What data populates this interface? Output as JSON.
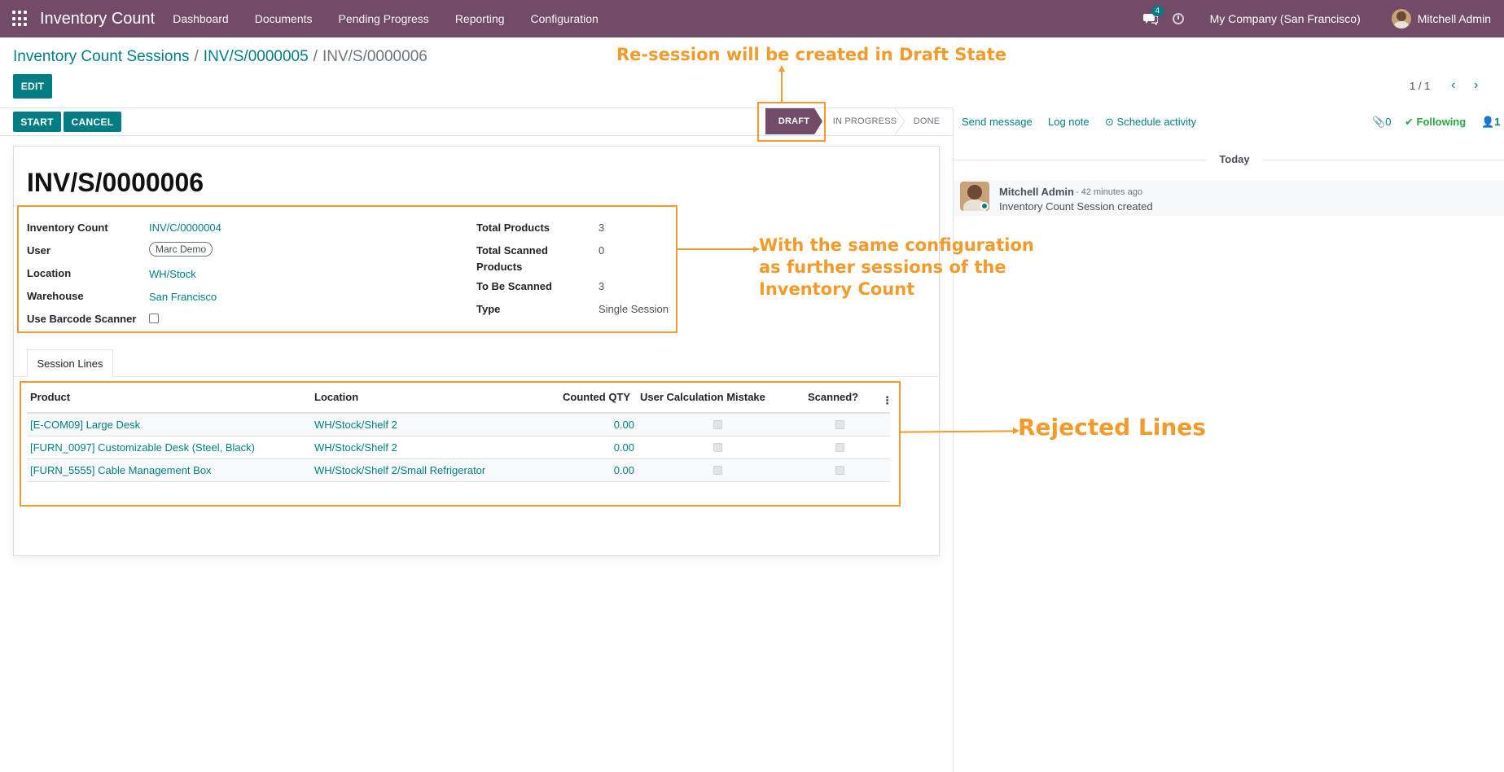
{
  "navbar": {
    "app_name": "Inventory Count",
    "menu": [
      "Dashboard",
      "Documents",
      "Pending Progress",
      "Reporting",
      "Configuration"
    ],
    "chat_count": "4",
    "company": "My Company (San Francisco)",
    "user": "Mitchell Admin",
    "color": "#714B67"
  },
  "breadcrumb": {
    "root": "Inventory Count Sessions",
    "parent": "INV/S/0000005",
    "current": "INV/S/0000006",
    "sep": "/"
  },
  "control": {
    "edit_label": "EDIT",
    "pager": "1 / 1"
  },
  "statusbar": {
    "start_label": "START",
    "cancel_label": "CANCEL",
    "stages": [
      "DRAFT",
      "IN PROGRESS",
      "DONE"
    ],
    "active_stage": "DRAFT"
  },
  "form": {
    "title": "INV/S/0000006",
    "left_fields": [
      {
        "label": "Inventory Count",
        "value": "INV/C/0000004"
      },
      {
        "label": "User",
        "value": "Marc Demo"
      },
      {
        "label": "Location",
        "value": "WH/Stock"
      },
      {
        "label": "Warehouse",
        "value": "San Francisco"
      },
      {
        "label": "Use Barcode Scanner",
        "value": ""
      }
    ],
    "right_fields": [
      {
        "label": "Total Products",
        "value": "3"
      },
      {
        "label_line1": "Total Scanned",
        "label_line2": "Products",
        "value": "0"
      },
      {
        "label": "To Be Scanned",
        "value": "3"
      },
      {
        "label": "Type",
        "value": "Single Session"
      }
    ]
  },
  "tabs": {
    "session_lines": "Session Lines"
  },
  "table": {
    "headers": [
      "Product",
      "Location",
      "Counted QTY",
      "User Calculation Mistake",
      "Scanned?"
    ],
    "rows": [
      {
        "product": "[E-COM09] Large Desk",
        "location": "WH/Stock/Shelf 2",
        "qty": "0.00"
      },
      {
        "product": "[FURN_0097] Customizable Desk (Steel, Black)",
        "location": "WH/Stock/Shelf 2",
        "qty": "0.00"
      },
      {
        "product": "[FURN_5555] Cable Management Box",
        "location": "WH/Stock/Shelf 2/Small Refrigerator",
        "qty": "0.00"
      }
    ]
  },
  "chatter": {
    "send_message": "Send message",
    "log_note": "Log note",
    "schedule_activity": "Schedule activity",
    "attachments": "0",
    "following": "Following",
    "followers": "1",
    "today": "Today",
    "message": {
      "author": "Mitchell Admin",
      "time": "- 42 minutes ago",
      "body": "Inventory Count Session created"
    }
  },
  "annotations": {
    "draft_note": "Re-session will be created in Draft State",
    "config_note_1": "With the same configuration",
    "config_note_2": "as further sessions of the",
    "config_note_3": "Inventory Count",
    "rejected_note": "Rejected Lines",
    "color": "#f39a2a"
  }
}
